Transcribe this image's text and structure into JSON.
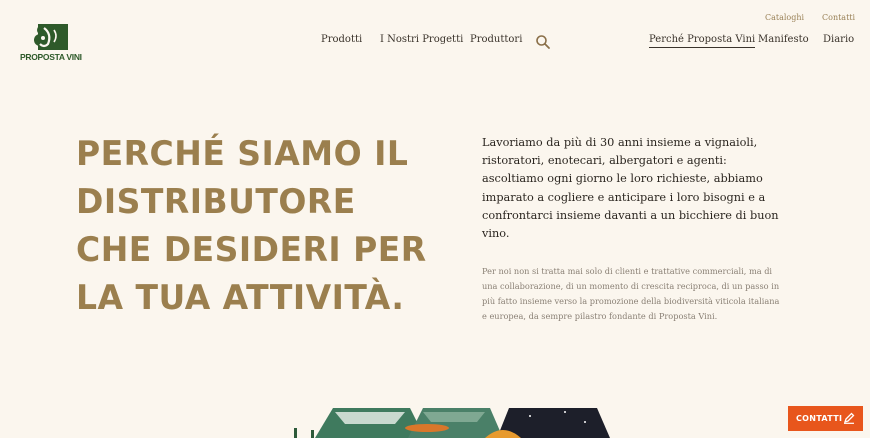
{
  "brand": {
    "name": "PROPOSTA VINI",
    "logo_color": "#2e5a2a"
  },
  "utility_nav": [
    {
      "label": "Cataloghi"
    },
    {
      "label": "Contatti"
    }
  ],
  "main_nav": [
    {
      "label": "Prodotti"
    },
    {
      "label": "I Nostri Progetti"
    },
    {
      "label": "Produttori"
    }
  ],
  "search": {
    "icon": "search-icon"
  },
  "secondary_nav": [
    {
      "label": "Perché Proposta Vini",
      "active": true
    },
    {
      "label": "Manifesto"
    },
    {
      "label": "Diario"
    }
  ],
  "hero": {
    "headline_lines": [
      "PERCHÉ SIAMO IL",
      "DISTRIBUTORE",
      "CHE DESIDERI PER",
      "LA TUA ATTIVITÀ."
    ],
    "lead": "Lavoriamo da più di 30 anni insieme a vignaioli, ristoratori, enotecari, albergatori e agenti: ascoltiamo ogni giorno le loro richieste, abbiamo imparato a cogliere e anticipare i loro bisogni e a confrontarci insieme davanti a un bicchiere di buon vino.",
    "body": "Per noi non si tratta mai solo di clienti e trattative commerciali, ma di una collaborazione, di un momento di crescita reciproca, di un passo in più fatto insieme verso la promozione della biodiversità viticola italiana e europea, da sempre pilastro fondante di Proposta Vini."
  },
  "contact_button": {
    "label": "CONTATTI",
    "icon": "pencil-icon",
    "color": "#e8561c"
  },
  "colors": {
    "background": "#fbf6ee",
    "headline": "#9b7f4e",
    "accent": "#e8561c"
  }
}
